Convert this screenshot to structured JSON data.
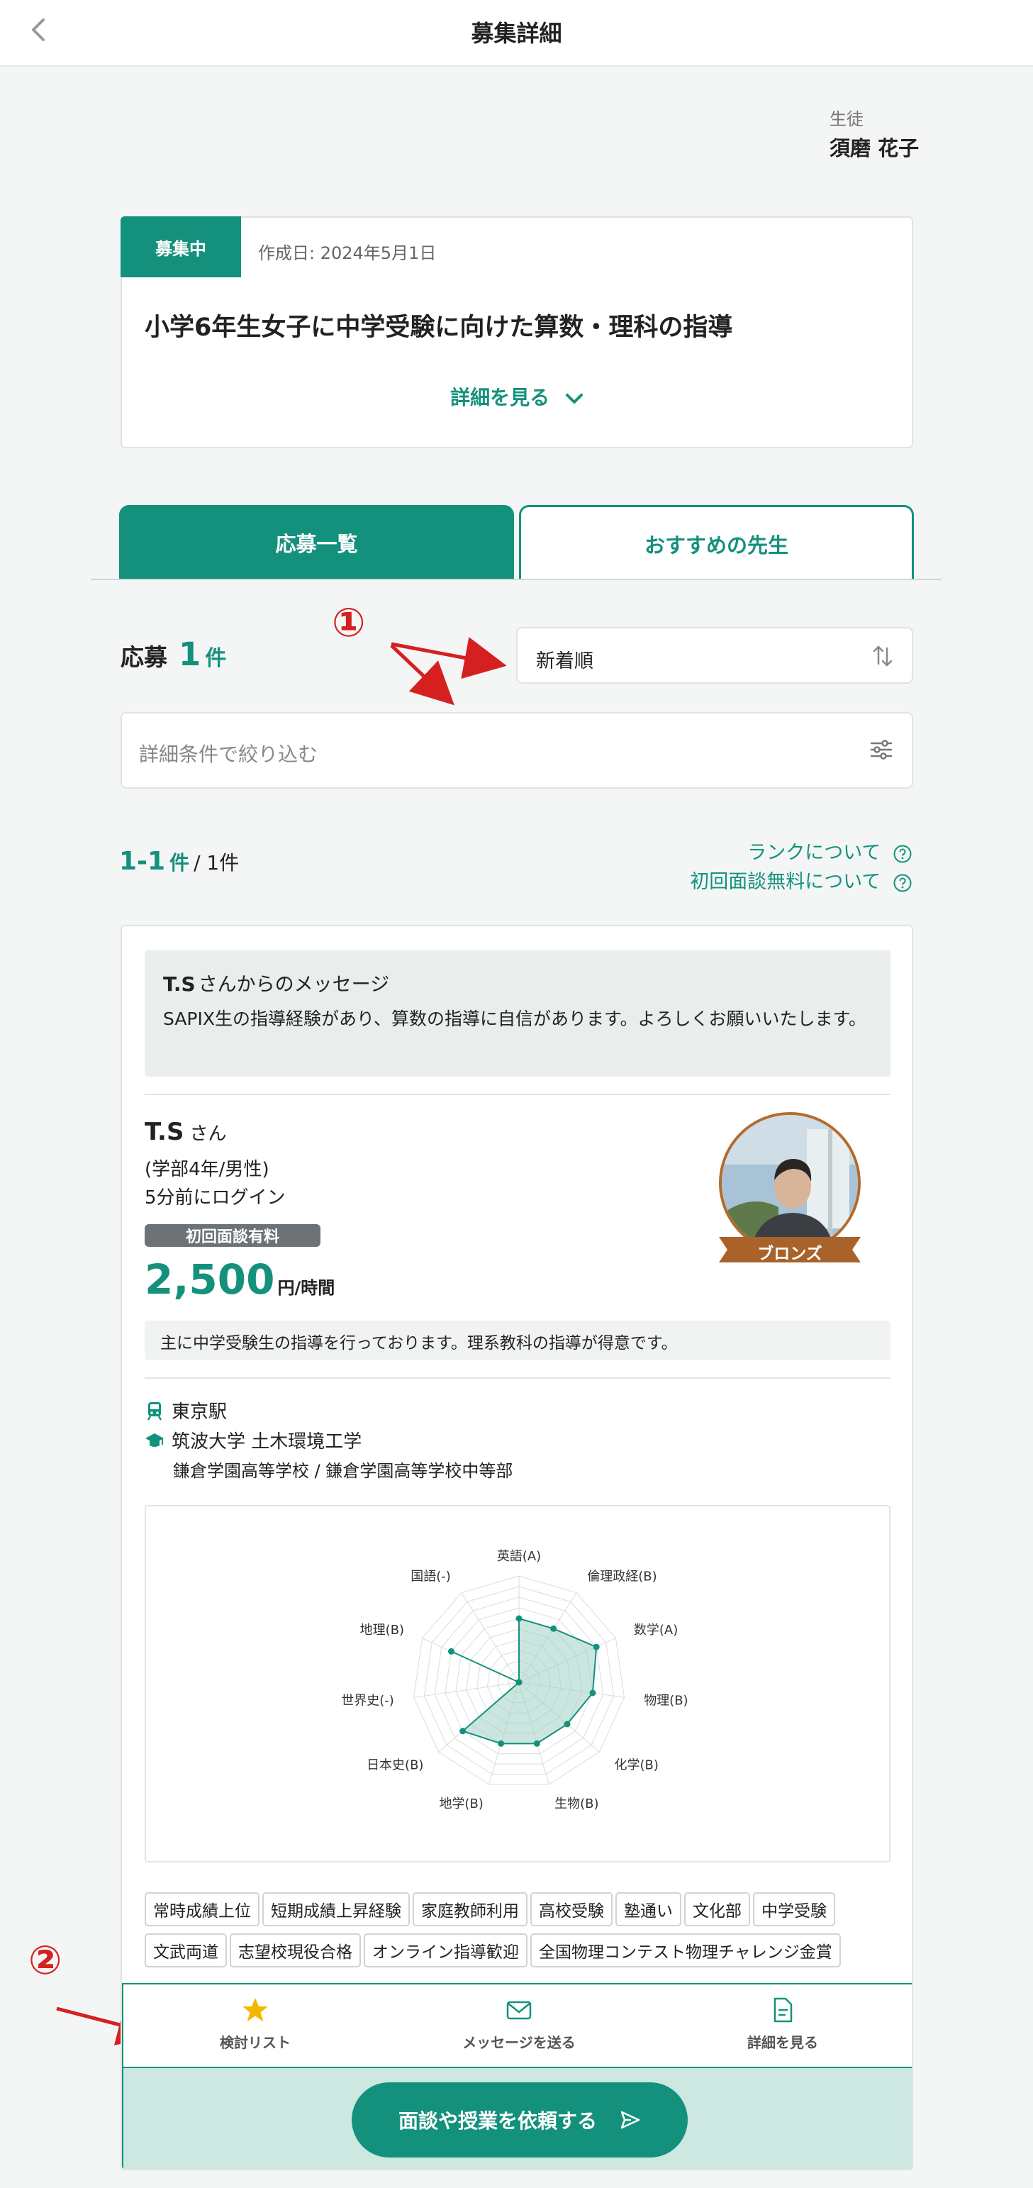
{
  "header": {
    "title": "募集詳細"
  },
  "student": {
    "label": "生徒",
    "name": "須磨 花子"
  },
  "posting": {
    "status": "募集中",
    "created": "作成日: 2024年5月1日",
    "title": "小学6年生女子に中学受験に向けた算数・理科の指導",
    "detail_toggle": "詳細を見る"
  },
  "tabs": [
    {
      "label": "応募一覧",
      "active": true
    },
    {
      "label": "おすすめの先生",
      "active": false
    }
  ],
  "applications": {
    "label": "応募",
    "count": "1",
    "unit": "件"
  },
  "sort": {
    "label": "新着順"
  },
  "filter": {
    "placeholder": "詳細条件で絞り込む"
  },
  "annotations": {
    "one": "①",
    "two": "②"
  },
  "range": {
    "shown": "1-1",
    "unit": "件",
    "total": "/ 1件"
  },
  "links": {
    "rank": "ランクについて",
    "free_interview": "初回面談無料について"
  },
  "tutor": {
    "message_from": "T.S",
    "message_from_suffix": "さんからのメッセージ",
    "message": "SAPIX生の指導経験があり、算数の指導に自信があります。よろしくお願いいたします。",
    "name": "T.S",
    "name_suffix": "さん",
    "profile": "(学部4年/男性)",
    "last_login": "5分前にログイン",
    "fee_badge": "初回面談有料",
    "price": "2,500",
    "price_unit": "円/時間",
    "rank": "ブロンズ",
    "intro": "主に中学受験生の指導を行っております。理系教科の指導が得意です。",
    "station": "東京駅",
    "university": "筑波大学 土木環境工学",
    "schools": "鎌倉学園高等学校 / 鎌倉学園高等学校中等部",
    "tags": [
      "常時成績上位",
      "短期成績上昇経験",
      "家庭教師利用",
      "高校受験",
      "塾通い",
      "文化部",
      "中学受験",
      "文武両道",
      "志望校現役合格",
      "オンライン指導歓迎",
      "全国物理コンテスト物理チャレンジ金賞"
    ]
  },
  "chart_data": {
    "type": "radar",
    "axes": [
      "英語(A)",
      "倫理政経(B)",
      "数学(A)",
      "物理(B)",
      "化学(B)",
      "生物(B)",
      "地学(B)",
      "日本史(B)",
      "世界史(-)",
      "地理(B)",
      "国語(-)"
    ],
    "values": [
      6,
      6,
      8,
      7,
      6,
      6,
      6,
      7,
      0,
      7,
      0
    ],
    "rlim": [
      0,
      10
    ],
    "colors": {
      "fill": "#9fd1c4",
      "stroke": "#14917c"
    }
  },
  "actions": {
    "watchlist": "検討リスト",
    "send_message": "メッセージを送る",
    "view_details": "詳細を見る",
    "request": "面談や授業を依頼する"
  },
  "colors": {
    "accent": "#14917c",
    "annotation": "#d62020"
  }
}
